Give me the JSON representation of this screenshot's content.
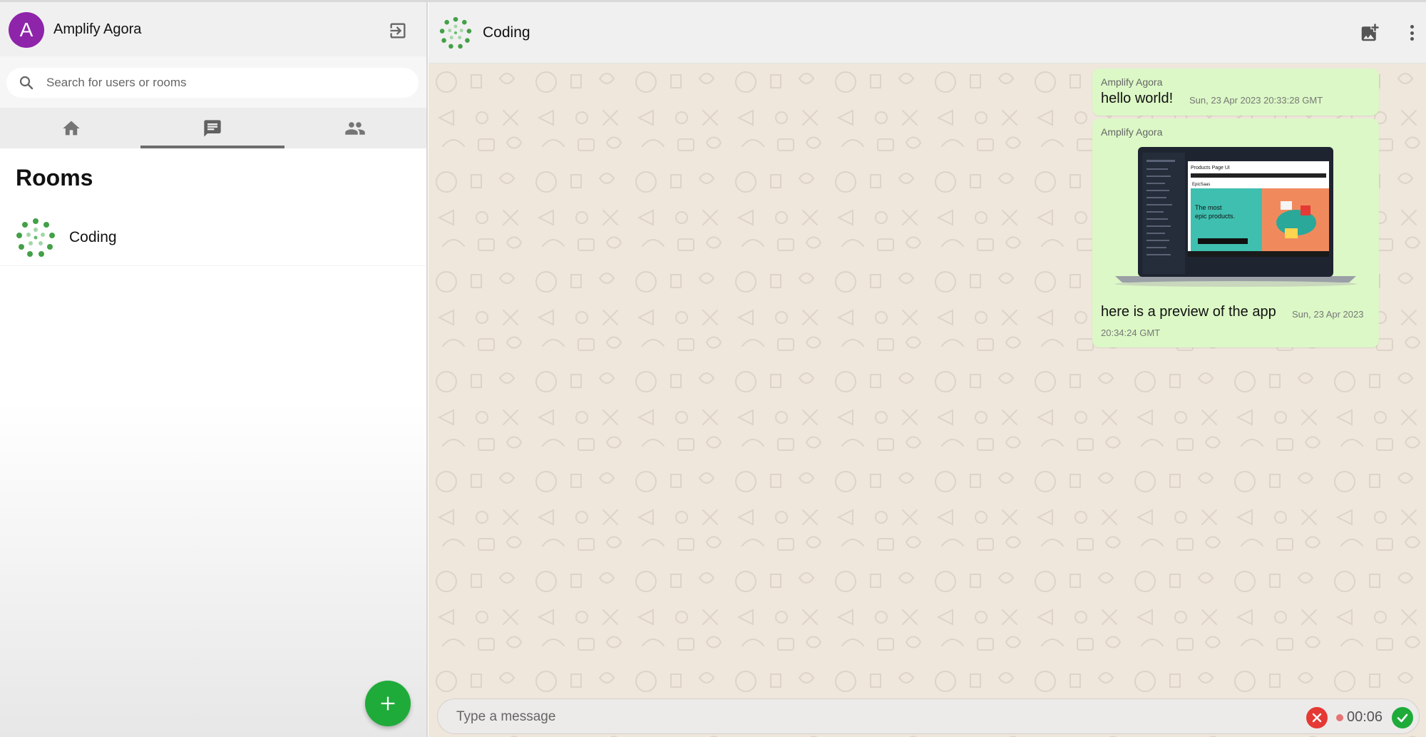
{
  "app": {
    "user_initial": "A",
    "user_name": "Amplify Agora"
  },
  "search": {
    "placeholder": "Search for users or rooms"
  },
  "tabs": [
    {
      "name": "home",
      "icon": "home-icon",
      "active": false
    },
    {
      "name": "chats",
      "icon": "chat-icon",
      "active": true
    },
    {
      "name": "users",
      "icon": "people-icon",
      "active": false
    }
  ],
  "rooms": {
    "title": "Rooms",
    "items": [
      {
        "name": "Coding",
        "icon": "green-dots-logo"
      }
    ]
  },
  "chat": {
    "title": "Coding",
    "messages": [
      {
        "sender": "Amplify Agora",
        "text": "hello world!",
        "timestamp": "Sun, 23 Apr 2023 20:33:28 GMT"
      },
      {
        "sender": "Amplify Agora",
        "text": "here is a preview of the app",
        "timestamp_line1": "Sun, 23 Apr 2023",
        "timestamp_line2": "20:34:24 GMT",
        "image": {
          "preview_title": "Products Page UI",
          "brand": "EpicSaas",
          "headline_line1": "The most",
          "headline_line2": "epic products."
        }
      }
    ]
  },
  "composer": {
    "placeholder": "Type a message",
    "recording_time": "00:06"
  },
  "colors": {
    "avatar": "#8e24aa",
    "bubble": "#dcf8c6",
    "accent_green": "#1fab3a",
    "cancel_red": "#e53935",
    "wallpaper": "#efe6dc"
  }
}
